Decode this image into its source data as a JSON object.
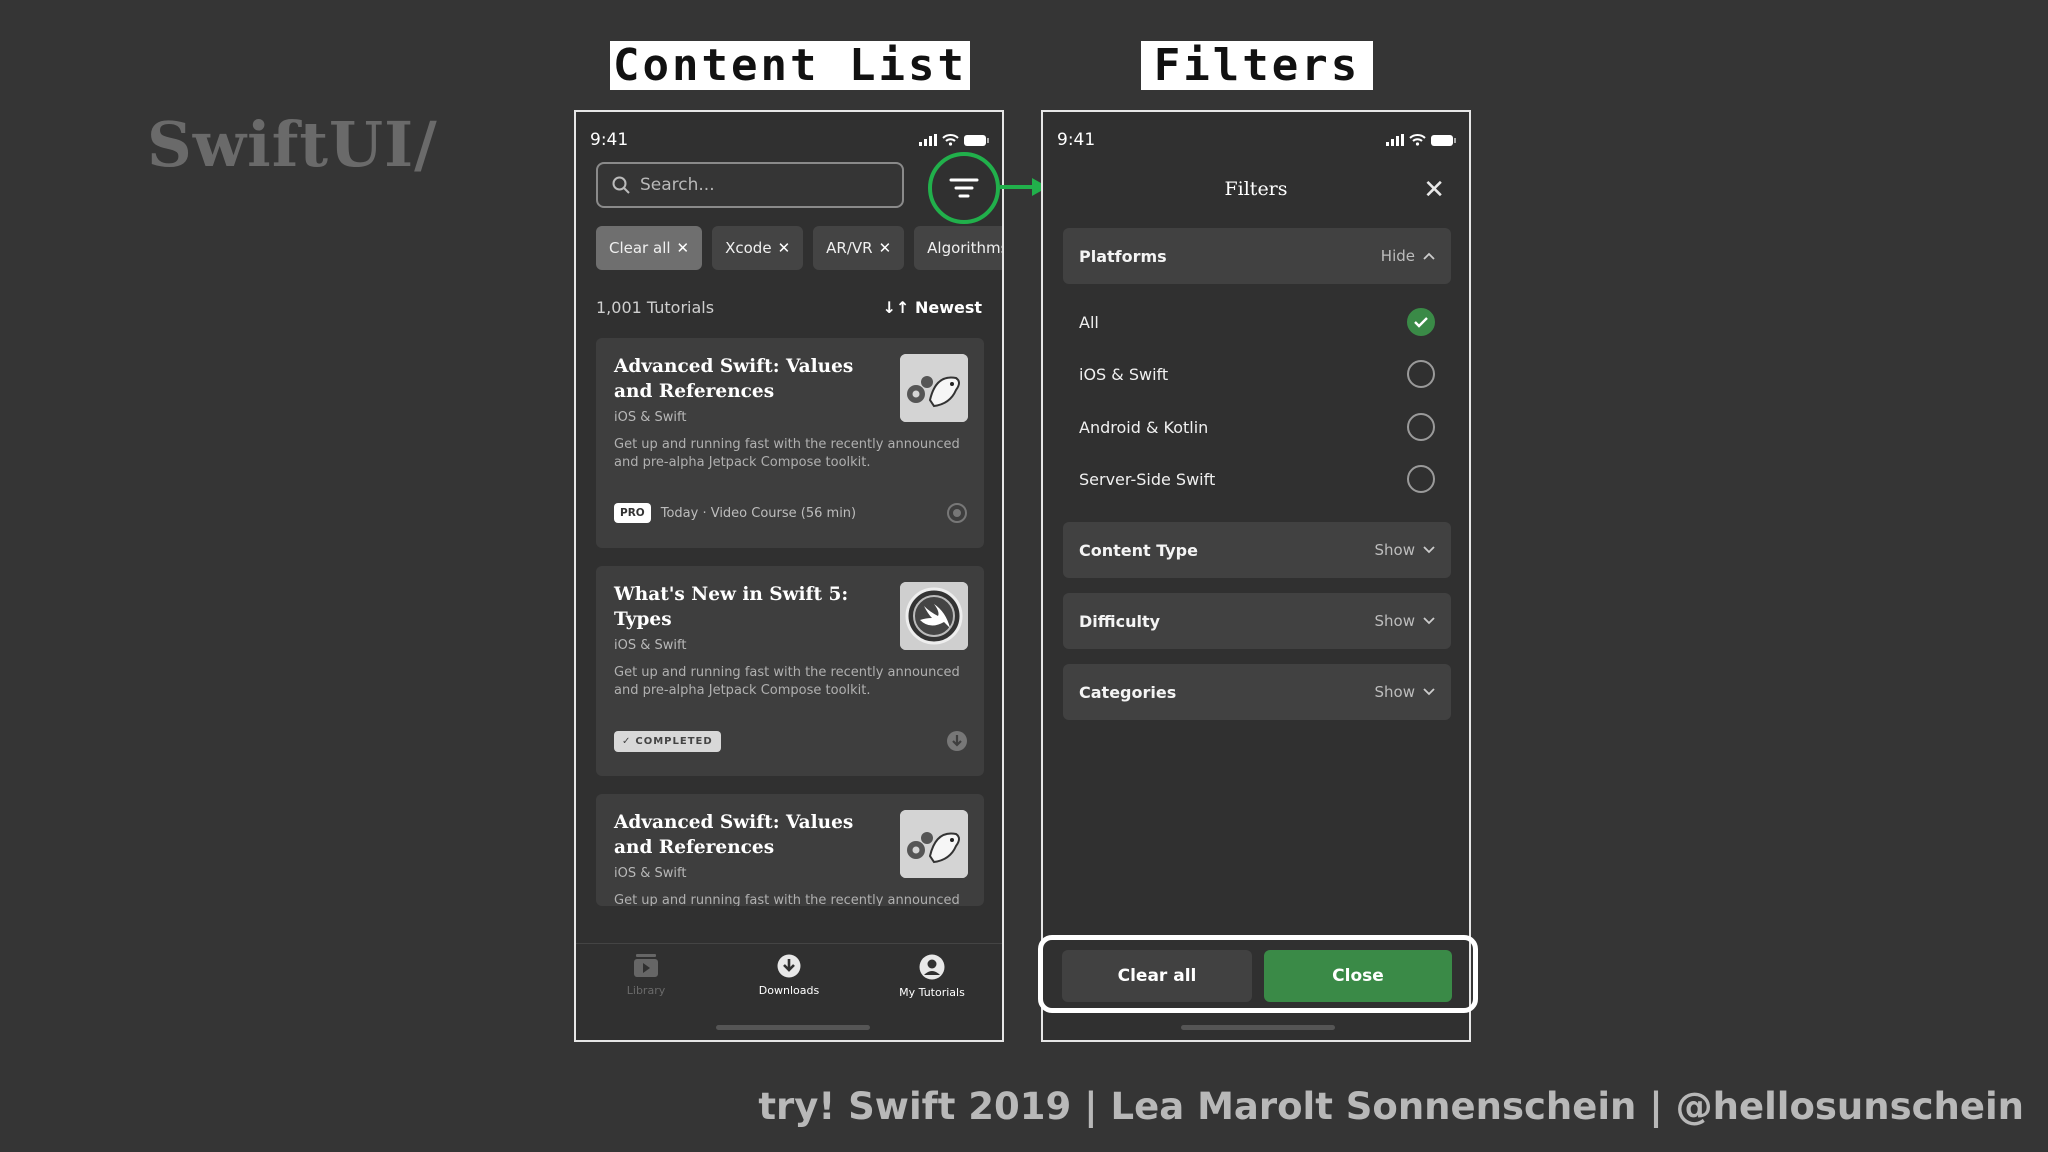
{
  "brand": "SwiftUI/",
  "labels": {
    "left": "Content List",
    "right": "Filters"
  },
  "status": {
    "time": "9:41"
  },
  "content_list": {
    "search_placeholder": "Search...",
    "chips": [
      "Clear all",
      "Xcode",
      "AR/VR",
      "Algorithms"
    ],
    "count": "1,001 Tutorials",
    "sort": "↓↑ Newest",
    "cards": [
      {
        "title": "Advanced Swift: Values and References",
        "subtitle": "iOS & Swift",
        "description": "Get up and running fast with the recently announced and pre-alpha Jetpack Compose toolkit.",
        "badge": "PRO",
        "meta": "Today · Video Course (56 min)"
      },
      {
        "title": "What's New in Swift 5: Types",
        "subtitle": "iOS & Swift",
        "description": "Get up and running fast with the recently announced and pre-alpha Jetpack Compose toolkit.",
        "badge": "COMPLETED"
      },
      {
        "title": "Advanced Swift: Values and References",
        "subtitle": "iOS & Swift",
        "description": "Get up and running fast with the recently announced and pre-alpha Jetpack Compose toolkit."
      }
    ],
    "tabs": [
      "Library",
      "Downloads",
      "My Tutorials"
    ]
  },
  "filters": {
    "title": "Filters",
    "platforms": {
      "label": "Platforms",
      "toggle": "Hide"
    },
    "options": [
      {
        "label": "All",
        "checked": true
      },
      {
        "label": "iOS & Swift",
        "checked": false
      },
      {
        "label": "Android & Kotlin",
        "checked": false
      },
      {
        "label": "Server-Side Swift",
        "checked": false
      }
    ],
    "sections": [
      {
        "label": "Content Type",
        "toggle": "Show"
      },
      {
        "label": "Difficulty",
        "toggle": "Show"
      },
      {
        "label": "Categories",
        "toggle": "Show"
      }
    ],
    "clear_label": "Clear all",
    "close_label": "Close"
  },
  "credit": "try! Swift 2019 | Lea Marolt Sonnenschein | @hellosunschein",
  "colors": {
    "accent_green": "#21b04b",
    "button_green": "#3a8a47"
  }
}
